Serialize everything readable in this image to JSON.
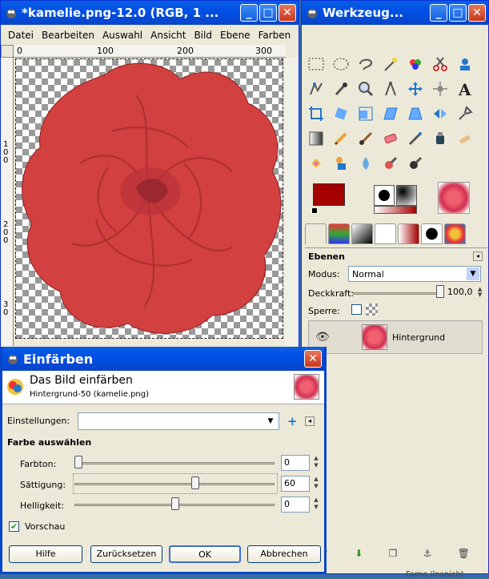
{
  "image_window": {
    "title": "*kamelie.png-12.0 (RGB, 1 ...",
    "menu": [
      "Datei",
      "Bearbeiten",
      "Auswahl",
      "Ansicht",
      "Bild",
      "Ebene",
      "Farben"
    ],
    "ruler_h": [
      "0",
      "100",
      "200",
      "300"
    ],
    "ruler_v": [
      "1\n0\n0",
      "2\n0\n0",
      "3\n0"
    ]
  },
  "toolbox": {
    "title": "Werkzeug...",
    "layers_title": "Ebenen",
    "mode_label": "Modus:",
    "mode_value": "Normal",
    "opacity_label": "Deckkraft:",
    "opacity_value": "100,0",
    "lock_label": "Sperre:",
    "layer_name": "Hintergrund",
    "footer_text": "Farne Ilnsnicht"
  },
  "dialog": {
    "title": "Einfärben",
    "heading": "Das Bild einfärben",
    "subheading": "Hintergrund-50 (kamelie.png)",
    "settings_label": "Einstellungen:",
    "section_label": "Farbe auswählen",
    "hue_label": "Farbton:",
    "hue_value": "0",
    "saturation_label": "Sättigung:",
    "saturation_value": "60",
    "lightness_label": "Helligkeit:",
    "lightness_value": "0",
    "preview_label": "Vorschau",
    "help_button": "Hilfe",
    "reset_button": "Zurücksetzen",
    "ok_button": "OK",
    "cancel_button": "Abbrechen"
  },
  "colors": {
    "fg": "#a50000",
    "bg": "#ffffff",
    "flower": "#d2403f"
  }
}
